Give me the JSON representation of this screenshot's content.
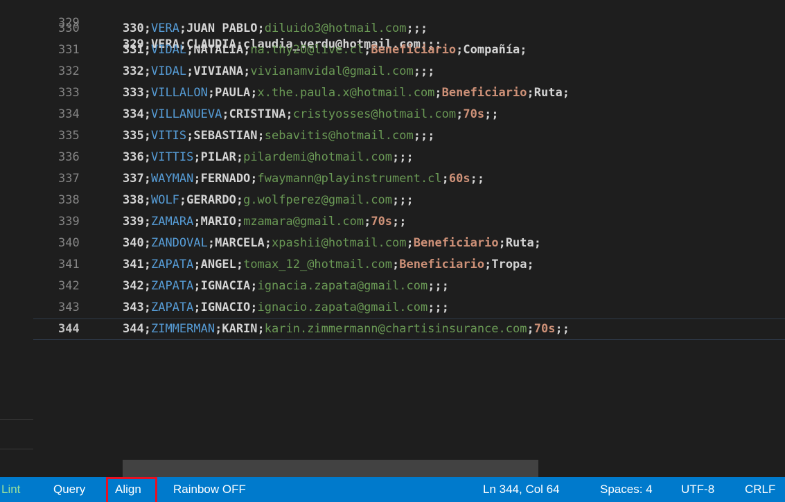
{
  "editor": {
    "partial_top_line": "329;VERA;CLAUDIA;claudia_verdu@hotmail.com;;;",
    "lines": [
      {
        "number": "330",
        "fields": [
          "330",
          "VERA",
          "JUAN PABLO",
          "diluido3@hotmail.com",
          "",
          ""
        ]
      },
      {
        "number": "331",
        "fields": [
          "331",
          "VIDAL",
          "NATALIA",
          "na.thy20@live.cl",
          "Beneficiario",
          "Compañía"
        ]
      },
      {
        "number": "332",
        "fields": [
          "332",
          "VIDAL",
          "VIVIANA",
          "vivianamvidal@gmail.com",
          "",
          ""
        ]
      },
      {
        "number": "333",
        "fields": [
          "333",
          "VILLALON",
          "PAULA",
          "x.the.paula.x@hotmail.com",
          "Beneficiario",
          "Ruta"
        ]
      },
      {
        "number": "334",
        "fields": [
          "334",
          "VILLANUEVA",
          "CRISTINA",
          "cristyosses@hotmail.com",
          "70s",
          ""
        ]
      },
      {
        "number": "335",
        "fields": [
          "335",
          "VITIS",
          "SEBASTIAN",
          "sebavitis@hotmail.com",
          "",
          ""
        ]
      },
      {
        "number": "336",
        "fields": [
          "336",
          "VITTIS",
          "PILAR",
          "pilardemi@hotmail.com",
          "",
          ""
        ]
      },
      {
        "number": "337",
        "fields": [
          "337",
          "WAYMAN",
          "FERNADO",
          "fwaymann@playinstrument.cl",
          "60s",
          ""
        ]
      },
      {
        "number": "338",
        "fields": [
          "338",
          "WOLF",
          "GERARDO",
          "g.wolfperez@gmail.com",
          "",
          ""
        ]
      },
      {
        "number": "339",
        "fields": [
          "339",
          "ZAMARA",
          "MARIO",
          "mzamara@gmail.com",
          "70s",
          ""
        ]
      },
      {
        "number": "340",
        "fields": [
          "340",
          "ZANDOVAL",
          "MARCELA",
          "xpashii@hotmail.com",
          "Beneficiario",
          "Ruta"
        ]
      },
      {
        "number": "341",
        "fields": [
          "341",
          "ZAPATA",
          "ANGEL",
          "tomax_12_@hotmail.com",
          "Beneficiario",
          "Tropa"
        ]
      },
      {
        "number": "342",
        "fields": [
          "342",
          "ZAPATA",
          "IGNACIA",
          "ignacia.zapata@gmail.com",
          "",
          ""
        ]
      },
      {
        "number": "343",
        "fields": [
          "343",
          "ZAPATA",
          "IGNACIO",
          "ignacio.zapata@gmail.com",
          "",
          ""
        ]
      },
      {
        "number": "344",
        "fields": [
          "344",
          "ZIMMERMAN",
          "KARIN",
          "karin.zimmermann@chartisinsurance.com",
          "70s",
          ""
        ]
      }
    ],
    "current_line": "344"
  },
  "statusbar": {
    "lint_label": "Lint",
    "query_label": "Query",
    "align_label": "Align",
    "rainbow_label": "Rainbow OFF",
    "cursor_position": "Ln 344, Col 64",
    "indentation": "Spaces: 4",
    "encoding": "UTF-8",
    "line_ending": "CRLF"
  },
  "colors": {
    "background": "#1e1e1e",
    "statusbar": "#007acc",
    "highlight_box": "#e81123",
    "field_name": "#569cd6",
    "field_email": "#6a9955",
    "field_extra": "#ce9178"
  }
}
